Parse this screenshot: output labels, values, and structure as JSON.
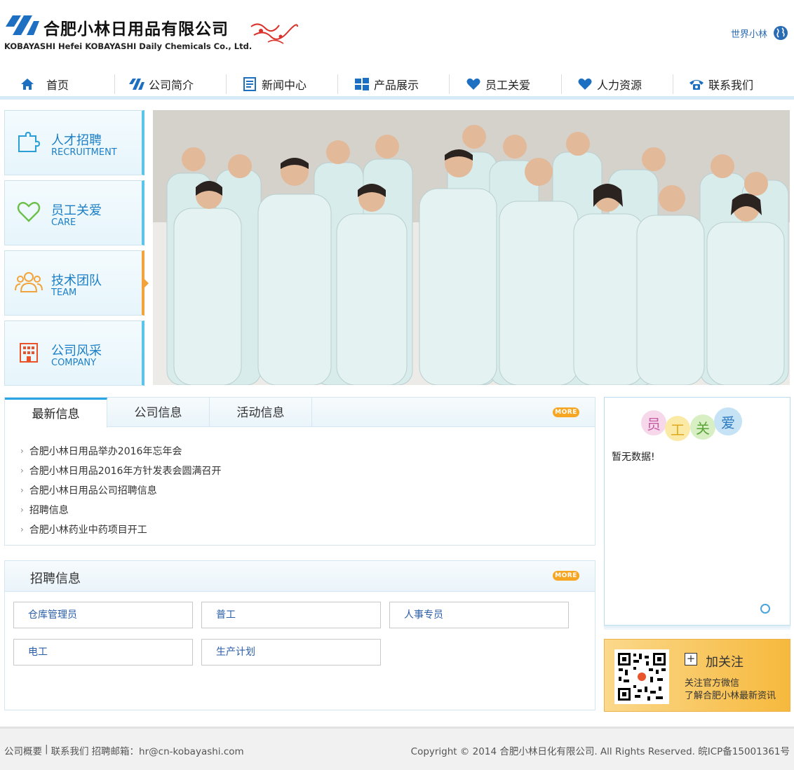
{
  "brand": {
    "name_cn": "合肥小林日用品有限公司",
    "name_en": "KOBAYASHI   Hefei KOBAYASHI Daily Chemicals Co., Ltd.",
    "accent": "#2a6cb3"
  },
  "header": {
    "world_link": "世界小林"
  },
  "nav": {
    "items": [
      {
        "label": "首页",
        "icon": "home-icon"
      },
      {
        "label": "公司简介",
        "icon": "logo-mark-icon"
      },
      {
        "label": "新闻中心",
        "icon": "document-icon"
      },
      {
        "label": "产品展示",
        "icon": "windows-grid-icon"
      },
      {
        "label": "员工关爱",
        "icon": "heart-icon"
      },
      {
        "label": "人力资源",
        "icon": "heart-icon"
      },
      {
        "label": "联系我们",
        "icon": "phone-icon"
      }
    ]
  },
  "sidebar": {
    "tiles": [
      {
        "cn": "人才招聘",
        "en": "RECRUITMENT",
        "icon": "puzzle-icon"
      },
      {
        "cn": "员工关爱",
        "en": "CARE",
        "icon": "heart-outline-icon"
      },
      {
        "cn": "技术团队",
        "en": "TEAM",
        "icon": "people-icon",
        "active": true
      },
      {
        "cn": "公司风采",
        "en": "COMPANY",
        "icon": "building-icon"
      }
    ]
  },
  "news": {
    "tabs": [
      "最新信息",
      "公司信息",
      "活动信息"
    ],
    "more": "MORE",
    "items": [
      "合肥小林日用品举办2016年忘年会",
      "合肥小林日用品2016年方针发表会圆满召开",
      "合肥小林日用品公司招聘信息",
      "招聘信息",
      "合肥小林药业中药项目开工"
    ]
  },
  "jobs": {
    "title": "招聘信息",
    "more": "MORE",
    "items": [
      "仓库管理员",
      "普工",
      "人事专员",
      "电工",
      "生产计划"
    ]
  },
  "care": {
    "title_chars": [
      "员",
      "工",
      "关",
      "爱"
    ],
    "empty": "暂无数据!"
  },
  "follow": {
    "title": "加关注",
    "line1": "关注官方微信",
    "line2": "了解合肥小林最新资讯"
  },
  "footer": {
    "links": [
      "公司概要",
      "|",
      "联系我们",
      "招聘邮箱：hr@cn-kobayashi.com"
    ],
    "copyright": "Copyright © 2014 合肥小林日化有限公司. All Rights Reserved. 皖ICP备15001361号"
  }
}
